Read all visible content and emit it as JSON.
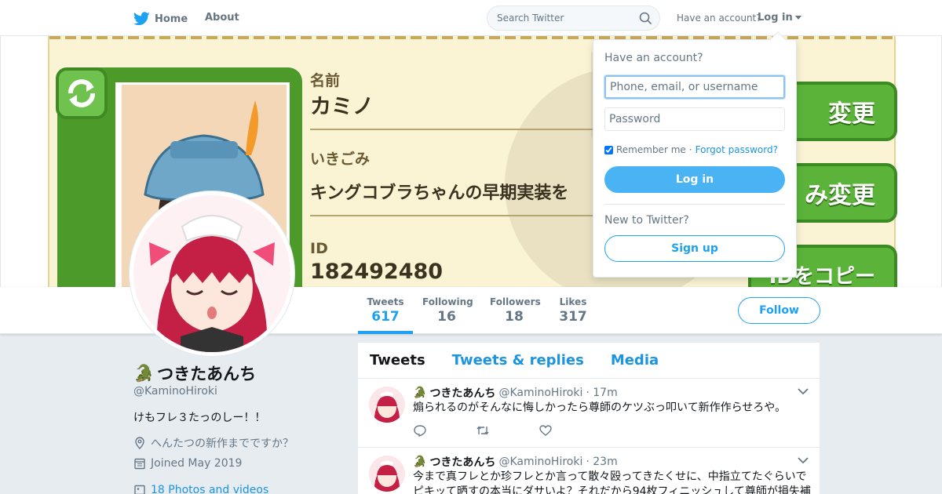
{
  "colors": {
    "accent": "#1da1f2",
    "link": "#1b95e0",
    "muted": "#657786",
    "background": "#e6ecf0",
    "banner_green": "#5bb33a"
  },
  "nav": {
    "home_label": "Home",
    "about_label": "About",
    "search_placeholder": "Search Twitter",
    "have_account": "Have an account?",
    "login_label": "Log in",
    "icons": [
      "twitter-bird-icon",
      "search-icon",
      "caret-down-icon"
    ]
  },
  "banner": {
    "name_label": "名前",
    "name_value": "カミノ",
    "motto_label": "いきごみ",
    "motto_value": "キングコブラちゃんの早期実装を",
    "id_label": "ID",
    "id_value": "182492480",
    "buttons": [
      "変更",
      "み変更",
      "IDをコピー"
    ]
  },
  "stats": [
    {
      "label": "Tweets",
      "value": "617",
      "active": true
    },
    {
      "label": "Following",
      "value": "16",
      "active": false
    },
    {
      "label": "Followers",
      "value": "18",
      "active": false
    },
    {
      "label": "Likes",
      "value": "317",
      "active": false
    }
  ],
  "follow_label": "Follow",
  "profile": {
    "emoji": "🐊",
    "name": "つきたあんち",
    "handle": "@KaminoHiroki",
    "bio": "けもフレ３たっのしー！！",
    "location": "へんたつの新作までですか？",
    "joined": "Joined May 2019",
    "photos": "18 Photos and videos"
  },
  "tabs": {
    "tweets": "Tweets",
    "replies": "Tweets & replies",
    "media": "Media"
  },
  "tweets": [
    {
      "name": "つきたあんち",
      "handle": "@KaminoHiroki",
      "time": "· 17m",
      "text": "煽られるのがそんなに悔しかったら尊師のケツぶっ叩いて新作作らせろや。"
    },
    {
      "name": "つきたあんち",
      "handle": "@KaminoHiroki",
      "time": "· 23m",
      "text": "今まで真フレとか珍フレとか言って散々殴ってきたくせに、中指立てたぐらいで",
      "text2": "ピキッて晒すの本当にダサいよ？それだから94枚フィニッシュして尊師が損失補"
    }
  ],
  "login": {
    "title": "Have an account?",
    "username_placeholder": "Phone, email, or username",
    "password_placeholder": "Password",
    "remember_label": "Remember me",
    "separator": "·",
    "forgot_label": "Forgot password?",
    "login_button": "Log in",
    "new_label": "New to Twitter?",
    "signup_button": "Sign up",
    "remember_checked": true
  }
}
